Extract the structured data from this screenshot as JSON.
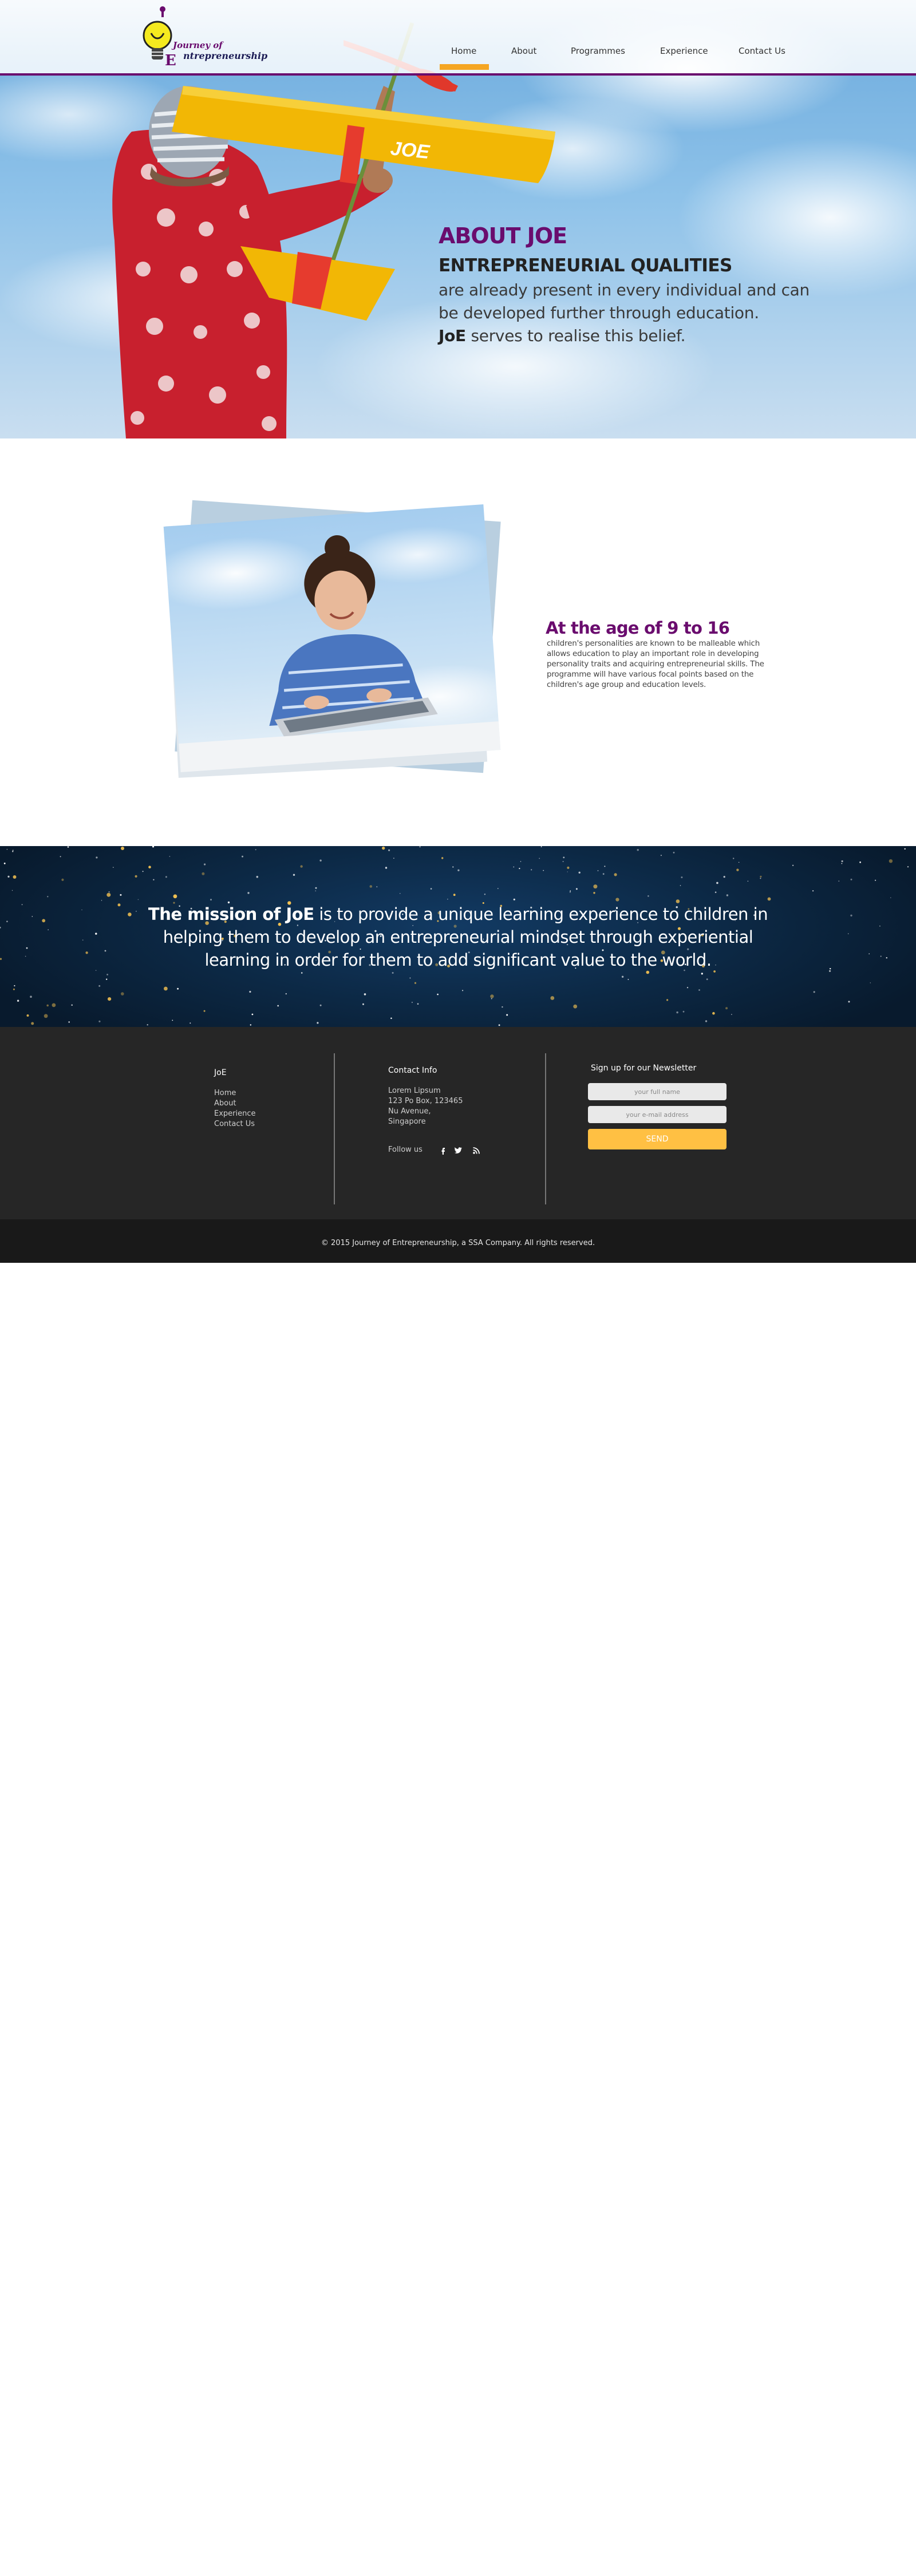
{
  "logo": {
    "line1": "Journey of",
    "line2": "ntrepreneurship"
  },
  "nav": {
    "items": [
      "Home",
      "About",
      "Programmes",
      "Experience",
      "Contact Us"
    ],
    "active": "Home"
  },
  "hero": {
    "plane_label": "JOE",
    "about_title": "ABOUT JOE",
    "about_subtitle": "ENTREPRENEURIAL QUALITIES",
    "line1": "are already present in every individual and can",
    "line2": "be developed further through education.",
    "line3_bold": "JoE",
    "line3_rest": " serves to realise this belief."
  },
  "age_section": {
    "title": "At the age of 9 to 16",
    "lines": [
      "children's personalities are known to be malleable which",
      "allows education to play an important role in developing",
      "personality traits and acquiring entrepreneurial skills. The",
      "programme will have various focal points based on the",
      "children's age group and education levels."
    ]
  },
  "mission": {
    "line1_bold": "The mission of JoE",
    "line1_rest": " is to provide a unique learning experience to children in",
    "line2": "helping them to develop an entrepreneurial mindset through experiential",
    "line3": "learning in order for them to add significant value to the world."
  },
  "footer": {
    "joe_heading": "JoE",
    "links": [
      "Home",
      "About",
      "Experience",
      "Contact Us"
    ],
    "contact_heading": "Contact Info",
    "contact_lines": [
      "Lorem Lipsum",
      "123 Po Box, 123465",
      "Nu Avenue,",
      "Singapore"
    ],
    "follow_label": "Follow us",
    "newsletter_heading": "Sign up for our Newsletter",
    "name_placeholder": "your full name",
    "email_placeholder": "your e-mail address",
    "send_label": "SEND",
    "social_icons": [
      "facebook-icon",
      "twitter-icon",
      "rss-icon"
    ]
  },
  "copyright": "© 2015 Journey of Entrepreneurship, a SSA Company.  All rights reserved.",
  "colors": {
    "purple": "#6a0c6e",
    "accent_orange": "#f5a623",
    "send_yellow": "#ffc043",
    "footer_bg": "#262626",
    "mission_bg": "#0c2844"
  }
}
